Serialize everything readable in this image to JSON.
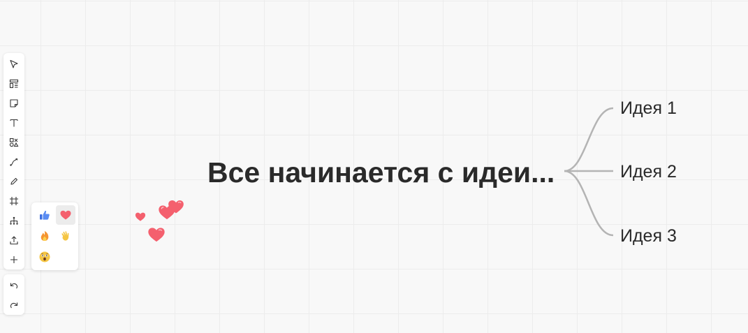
{
  "mindmap": {
    "root": "Все начинается с идеи...",
    "children": [
      "Идея 1",
      "Идея 2",
      "Идея 3"
    ],
    "connector_color": "#b4b4b4"
  },
  "toolbar": {
    "tools": [
      "select-icon",
      "template-icon",
      "sticky-note-icon",
      "text-icon",
      "shapes-icon",
      "connector-icon",
      "pen-icon",
      "frame-icon",
      "mindmap-icon",
      "upload-icon",
      "plus-icon"
    ],
    "history": [
      "undo-icon",
      "redo-icon"
    ]
  },
  "reactions": {
    "items": [
      "thumbs-up-icon",
      "heart-icon",
      "fire-icon",
      "wave-icon",
      "surprised-icon"
    ],
    "selected": "heart-icon",
    "heart_color": "#f4606e"
  }
}
